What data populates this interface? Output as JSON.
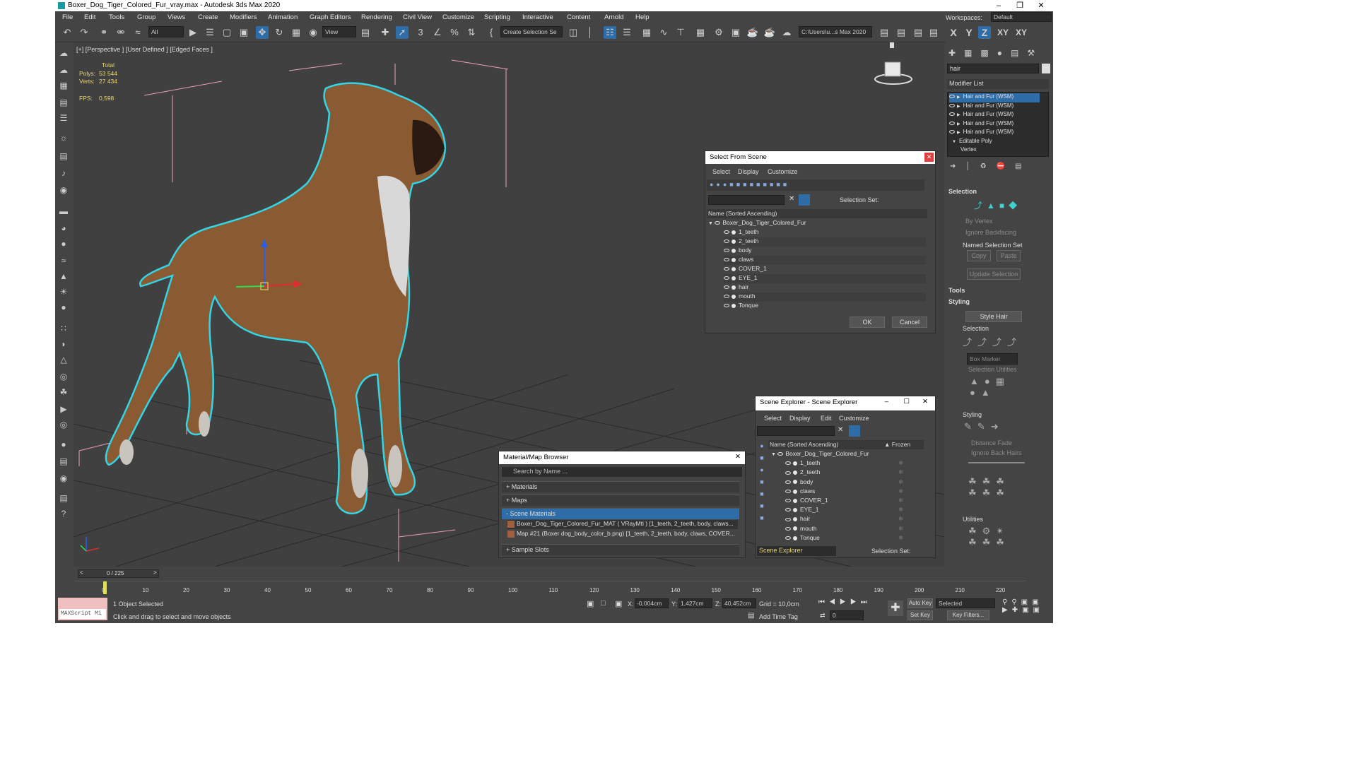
{
  "window": {
    "title": "Boxer_Dog_Tiger_Colored_Fur_vray.max - Autodesk 3ds Max 2020",
    "workspace_label": "Workspaces:",
    "workspace_value": "Default"
  },
  "menu": [
    "File",
    "Edit",
    "Tools",
    "Group",
    "Views",
    "Create",
    "Modifiers",
    "Animation",
    "Graph Editors",
    "Rendering",
    "Civil View",
    "Customize",
    "Scripting",
    "Interactive",
    "Content",
    "Arnold",
    "Help"
  ],
  "toolbar": {
    "filter_value": "All",
    "refcoord_value": "View",
    "selset_value": "Create Selection Se",
    "path_value": "C:\\Users\\u...s Max 2020",
    "axis": [
      "X",
      "Y",
      "Z",
      "XY",
      "XY"
    ]
  },
  "viewport": {
    "label": "[+] [Perspective ] [User Defined ] [Edged Faces ]",
    "stats_header": "Total",
    "polys_label": "Polys:",
    "polys_value": "53 544",
    "verts_label": "Verts:",
    "verts_value": "27 434",
    "fps_label": "FPS:",
    "fps_value": "0,598"
  },
  "command_panel": {
    "search_value": "hair",
    "modifier_list_label": "Modifier List",
    "stack": [
      "Hair and Fur (WSM)",
      "Hair and Fur (WSM)",
      "Hair and Fur (WSM)",
      "Hair and Fur (WSM)",
      "Hair and Fur (WSM)",
      "Editable Poly",
      "Vertex"
    ],
    "selection_title": "Selection",
    "by_vertex": "By Vertex",
    "ignore_backfacing": "Ignore Backfacing",
    "named_selection_set": "Named Selection Set",
    "copy": "Copy",
    "paste": "Paste",
    "update_selection": "Update Selection",
    "tools_title": "Tools",
    "styling_title": "Styling",
    "style_hair": "Style Hair",
    "selection_sub": "Selection",
    "box_marker": "Box Marker",
    "selection_utilities": "Selection Utilities",
    "styling_sub": "Styling",
    "distance_fade": "Distance Fade",
    "ignore_back_hairs": "Ignore Back Hairs",
    "utilities_sub": "Utilities"
  },
  "select_from_scene": {
    "title": "Select From Scene",
    "menu": [
      "Select",
      "Display",
      "Customize"
    ],
    "selection_set_label": "Selection Set:",
    "column_header": "Name (Sorted Ascending)",
    "root": "Boxer_Dog_Tiger_Colored_Fur",
    "items": [
      "1_teeth",
      "2_teeth",
      "body",
      "claws",
      "COVER_1",
      "EYE_1",
      "hair",
      "mouth",
      "Tonque"
    ],
    "ok": "OK",
    "cancel": "Cancel"
  },
  "scene_explorer": {
    "title": "Scene Explorer - Scene Explorer",
    "menu": [
      "Select",
      "Display",
      "Edit",
      "Customize"
    ],
    "column_header": "Name (Sorted Ascending)",
    "frozen_header": "▲ Frozen",
    "root": "Boxer_Dog_Tiger_Colored_Fur",
    "items": [
      "1_teeth",
      "2_teeth",
      "body",
      "claws",
      "COVER_1",
      "EYE_1",
      "hair",
      "mouth",
      "Tonque"
    ],
    "footer_explorer": "Scene Explorer",
    "selection_set_label": "Selection Set:"
  },
  "material_browser": {
    "title": "Material/Map Browser",
    "search_placeholder": "Search by Name ...",
    "sections": [
      "+ Materials",
      "+ Maps",
      "- Scene Materials",
      "+ Sample Slots"
    ],
    "scene_materials": [
      "Boxer_Dog_Tiger_Colored_Fur_MAT  ( VRayMtl )  [1_teeth, 2_teeth, body, claws...",
      "Map #21 (Boxer dog_body_color_b.png)  [1_teeth, 2_teeth, body, claws, COVER..."
    ]
  },
  "timeline": {
    "frame_counter": "0 / 225",
    "ticks": [
      "0",
      "10",
      "20",
      "30",
      "40",
      "50",
      "60",
      "70",
      "80",
      "90",
      "100",
      "110",
      "120",
      "130",
      "140",
      "150",
      "160",
      "170",
      "180",
      "190",
      "200",
      "210",
      "220"
    ]
  },
  "status": {
    "maxscript": "MAXScript Mi",
    "selected": "1 Object Selected",
    "prompt": "Click and drag to select and move objects",
    "x_label": "X:",
    "x_value": "-0,004cm",
    "y_label": "Y:",
    "y_value": "1,427cm",
    "z_label": "Z:",
    "z_value": "40,452cm",
    "grid": "Grid = 10,0cm",
    "add_time_tag": "Add Time Tag",
    "auto_key": "Auto Key",
    "selected_dd": "Selected",
    "set_key": "Set Key",
    "key_filters": "Key Filters...",
    "frame_value": "0"
  },
  "colors": {
    "accent": "#2f6da8",
    "viewport_bg": "#404040",
    "selection_outline": "#33d6e6",
    "stats_text": "#e8d770"
  }
}
